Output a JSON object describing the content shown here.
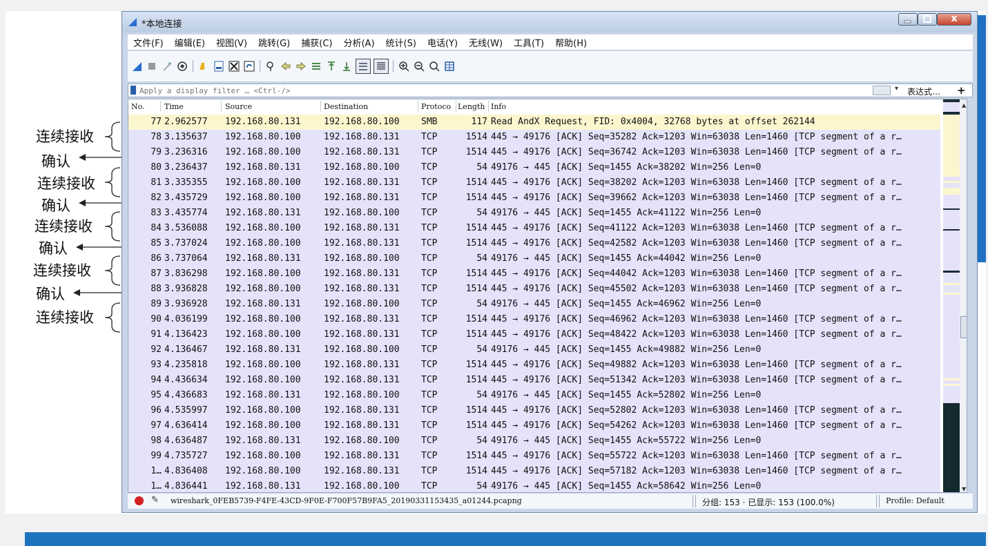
{
  "window": {
    "title": "*本地连接",
    "close_label": "x"
  },
  "menu": [
    "文件(F)",
    "编辑(E)",
    "视图(V)",
    "跳转(G)",
    "捕获(C)",
    "分析(A)",
    "统计(S)",
    "电话(Y)",
    "无线(W)",
    "工具(T)",
    "帮助(H)"
  ],
  "toolbar": {
    "icons": [
      "shark-fin-start-icon",
      "stop-square-icon",
      "restart-icon",
      "options-gear-icon",
      "open-folder-icon",
      "save-file-icon",
      "close-file-icon",
      "reload-icon",
      "find-icon",
      "go-back-icon",
      "go-forward-icon",
      "go-to-packet-icon",
      "go-first-icon",
      "go-last-icon",
      "autoscroll-icon",
      "colorize-icon",
      "zoom-in-icon",
      "zoom-out-icon",
      "normal-size-icon",
      "resize-columns-icon"
    ]
  },
  "filter": {
    "placeholder": "Apply a display filter … <Ctrl-/>",
    "expression_label": "表达式…",
    "add_label": "+"
  },
  "columns": [
    "No.",
    "Time",
    "Source",
    "Destination",
    "Protoco",
    "Length",
    "Info"
  ],
  "packets": [
    {
      "no": "77",
      "time": "2.962577",
      "src": "192.168.80.131",
      "dst": "192.168.80.100",
      "proto": "SMB",
      "len": "117",
      "info": "Read AndX Request, FID: 0x4004, 32768 bytes at offset 262144"
    },
    {
      "no": "78",
      "time": "3.135637",
      "src": "192.168.80.100",
      "dst": "192.168.80.131",
      "proto": "TCP",
      "len": "1514",
      "info": "445 → 49176 [ACK] Seq=35282 Ack=1203 Win=63038 Len=1460 [TCP segment of a r…"
    },
    {
      "no": "79",
      "time": "3.236316",
      "src": "192.168.80.100",
      "dst": "192.168.80.131",
      "proto": "TCP",
      "len": "1514",
      "info": "445 → 49176 [ACK] Seq=36742 Ack=1203 Win=63038 Len=1460 [TCP segment of a r…"
    },
    {
      "no": "80",
      "time": "3.236437",
      "src": "192.168.80.131",
      "dst": "192.168.80.100",
      "proto": "TCP",
      "len": "54",
      "info": "49176 → 445 [ACK] Seq=1455 Ack=38202 Win=256 Len=0"
    },
    {
      "no": "81",
      "time": "3.335355",
      "src": "192.168.80.100",
      "dst": "192.168.80.131",
      "proto": "TCP",
      "len": "1514",
      "info": "445 → 49176 [ACK] Seq=38202 Ack=1203 Win=63038 Len=1460 [TCP segment of a r…"
    },
    {
      "no": "82",
      "time": "3.435729",
      "src": "192.168.80.100",
      "dst": "192.168.80.131",
      "proto": "TCP",
      "len": "1514",
      "info": "445 → 49176 [ACK] Seq=39662 Ack=1203 Win=63038 Len=1460 [TCP segment of a r…"
    },
    {
      "no": "83",
      "time": "3.435774",
      "src": "192.168.80.131",
      "dst": "192.168.80.100",
      "proto": "TCP",
      "len": "54",
      "info": "49176 → 445 [ACK] Seq=1455 Ack=41122 Win=256 Len=0"
    },
    {
      "no": "84",
      "time": "3.536088",
      "src": "192.168.80.100",
      "dst": "192.168.80.131",
      "proto": "TCP",
      "len": "1514",
      "info": "445 → 49176 [ACK] Seq=41122 Ack=1203 Win=63038 Len=1460 [TCP segment of a r…"
    },
    {
      "no": "85",
      "time": "3.737024",
      "src": "192.168.80.100",
      "dst": "192.168.80.131",
      "proto": "TCP",
      "len": "1514",
      "info": "445 → 49176 [ACK] Seq=42582 Ack=1203 Win=63038 Len=1460 [TCP segment of a r…"
    },
    {
      "no": "86",
      "time": "3.737064",
      "src": "192.168.80.131",
      "dst": "192.168.80.100",
      "proto": "TCP",
      "len": "54",
      "info": "49176 → 445 [ACK] Seq=1455 Ack=44042 Win=256 Len=0"
    },
    {
      "no": "87",
      "time": "3.836298",
      "src": "192.168.80.100",
      "dst": "192.168.80.131",
      "proto": "TCP",
      "len": "1514",
      "info": "445 → 49176 [ACK] Seq=44042 Ack=1203 Win=63038 Len=1460 [TCP segment of a r…"
    },
    {
      "no": "88",
      "time": "3.936828",
      "src": "192.168.80.100",
      "dst": "192.168.80.131",
      "proto": "TCP",
      "len": "1514",
      "info": "445 → 49176 [ACK] Seq=45502 Ack=1203 Win=63038 Len=1460 [TCP segment of a r…"
    },
    {
      "no": "89",
      "time": "3.936928",
      "src": "192.168.80.131",
      "dst": "192.168.80.100",
      "proto": "TCP",
      "len": "54",
      "info": "49176 → 445 [ACK] Seq=1455 Ack=46962 Win=256 Len=0"
    },
    {
      "no": "90",
      "time": "4.036199",
      "src": "192.168.80.100",
      "dst": "192.168.80.131",
      "proto": "TCP",
      "len": "1514",
      "info": "445 → 49176 [ACK] Seq=46962 Ack=1203 Win=63038 Len=1460 [TCP segment of a r…"
    },
    {
      "no": "91",
      "time": "4.136423",
      "src": "192.168.80.100",
      "dst": "192.168.80.131",
      "proto": "TCP",
      "len": "1514",
      "info": "445 → 49176 [ACK] Seq=48422 Ack=1203 Win=63038 Len=1460 [TCP segment of a r…"
    },
    {
      "no": "92",
      "time": "4.136467",
      "src": "192.168.80.131",
      "dst": "192.168.80.100",
      "proto": "TCP",
      "len": "54",
      "info": "49176 → 445 [ACK] Seq=1455 Ack=49882 Win=256 Len=0"
    },
    {
      "no": "93",
      "time": "4.235818",
      "src": "192.168.80.100",
      "dst": "192.168.80.131",
      "proto": "TCP",
      "len": "1514",
      "info": "445 → 49176 [ACK] Seq=49882 Ack=1203 Win=63038 Len=1460 [TCP segment of a r…"
    },
    {
      "no": "94",
      "time": "4.436634",
      "src": "192.168.80.100",
      "dst": "192.168.80.131",
      "proto": "TCP",
      "len": "1514",
      "info": "445 → 49176 [ACK] Seq=51342 Ack=1203 Win=63038 Len=1460 [TCP segment of a r…"
    },
    {
      "no": "95",
      "time": "4.436683",
      "src": "192.168.80.131",
      "dst": "192.168.80.100",
      "proto": "TCP",
      "len": "54",
      "info": "49176 → 445 [ACK] Seq=1455 Ack=52802 Win=256 Len=0"
    },
    {
      "no": "96",
      "time": "4.535997",
      "src": "192.168.80.100",
      "dst": "192.168.80.131",
      "proto": "TCP",
      "len": "1514",
      "info": "445 → 49176 [ACK] Seq=52802 Ack=1203 Win=63038 Len=1460 [TCP segment of a r…"
    },
    {
      "no": "97",
      "time": "4.636414",
      "src": "192.168.80.100",
      "dst": "192.168.80.131",
      "proto": "TCP",
      "len": "1514",
      "info": "445 → 49176 [ACK] Seq=54262 Ack=1203 Win=63038 Len=1460 [TCP segment of a r…"
    },
    {
      "no": "98",
      "time": "4.636487",
      "src": "192.168.80.131",
      "dst": "192.168.80.100",
      "proto": "TCP",
      "len": "54",
      "info": "49176 → 445 [ACK] Seq=1455 Ack=55722 Win=256 Len=0"
    },
    {
      "no": "99",
      "time": "4.735727",
      "src": "192.168.80.100",
      "dst": "192.168.80.131",
      "proto": "TCP",
      "len": "1514",
      "info": "445 → 49176 [ACK] Seq=55722 Ack=1203 Win=63038 Len=1460 [TCP segment of a r…"
    },
    {
      "no": "1…",
      "time": "4.836408",
      "src": "192.168.80.100",
      "dst": "192.168.80.131",
      "proto": "TCP",
      "len": "1514",
      "info": "445 → 49176 [ACK] Seq=57182 Ack=1203 Win=63038 Len=1460 [TCP segment of a r…"
    },
    {
      "no": "1…",
      "time": "4.836441",
      "src": "192.168.80.131",
      "dst": "192.168.80.100",
      "proto": "TCP",
      "len": "54",
      "info": "49176 → 445 [ACK] Seq=1455 Ack=58642 Win=256 Len=0"
    }
  ],
  "annotations": {
    "continuous_receive": "连续接收",
    "confirm": "确认"
  },
  "status": {
    "filename": "wireshark_0FEB5739-F4FE-43CD-9F0E-F700F57B9FA5_20190331153435_a01244.pcapng",
    "packets": "分组: 153 · 已显示: 153 (100.0%)",
    "profile": "Profile: Default"
  },
  "colors": {
    "tcp_row": "#e5e3fa",
    "smb_row": "#fcf6cf",
    "accent_blue": "#1e73be",
    "capture_dot": "#d42020"
  }
}
